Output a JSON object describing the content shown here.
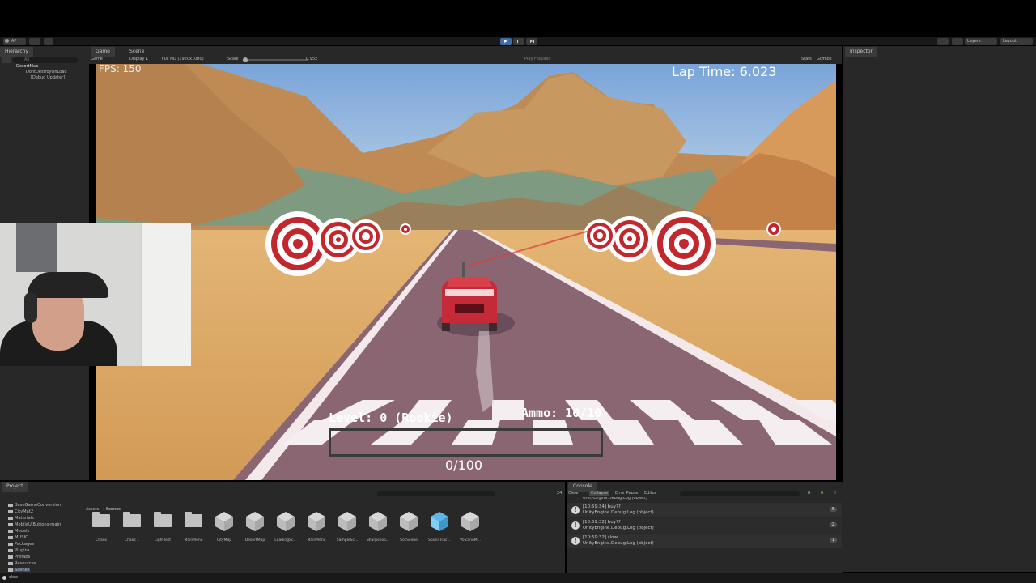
{
  "toolbar": {
    "account_label": "AP",
    "layers_label": "Layers",
    "layout_label": "Layout"
  },
  "hierarchy": {
    "tab_label": "Hierarchy",
    "search_placeholder": "All",
    "items": [
      {
        "label": "DesertMap"
      },
      {
        "label": "DontDestroyOnLoad"
      },
      {
        "label": "[Debug Updater]"
      }
    ]
  },
  "game_view": {
    "tabs": [
      {
        "label": "Game"
      },
      {
        "label": "Scene"
      }
    ],
    "display_mode": "Game",
    "display": "Display 1",
    "resolution": "Full HD (1920x1080)",
    "scale_label": "Scale",
    "scale_value": "0.95x",
    "play_mode": "Play Focused",
    "stats_label": "Stats",
    "gizmos_label": "Gizmos"
  },
  "inspector": {
    "tab_label": "Inspector"
  },
  "hud": {
    "fps": "FPS: 150",
    "lap_time": "Lap Time: 6.023",
    "level": "Level: 0 (Rookie)",
    "ammo": "Ammo: 10/10",
    "progress_text": "0/100",
    "progress_fraction": 0.0
  },
  "project": {
    "tab_label": "Project",
    "breadcrumb": [
      "Assets",
      "Scenes"
    ],
    "asset_count": "24",
    "tree": [
      {
        "label": "BaseGameConversion"
      },
      {
        "label": "CityMat2"
      },
      {
        "label": "Materials"
      },
      {
        "label": "MobileUIButtons-main"
      },
      {
        "label": "Models"
      },
      {
        "label": "MUSIC"
      },
      {
        "label": "Packages"
      },
      {
        "label": "Plugins"
      },
      {
        "label": "Prefabs"
      },
      {
        "label": "Resources"
      },
      {
        "label": "Scenes"
      }
    ],
    "assets": [
      {
        "label": "Chaos",
        "icon": "folder-icon"
      },
      {
        "label": "Chaos 1",
        "icon": "folder-icon"
      },
      {
        "label": "LightTest",
        "icon": "folder-icon"
      },
      {
        "label": "MainMenu",
        "icon": "folder-icon"
      },
      {
        "label": "CityMap",
        "icon": "unity-scene-icon"
      },
      {
        "label": "DesertMap",
        "icon": "unity-scene-icon"
      },
      {
        "label": "LoadingSc...",
        "icon": "unity-scene-icon"
      },
      {
        "label": "MainMenu",
        "icon": "unity-scene-icon"
      },
      {
        "label": "SampleSc...",
        "icon": "unity-scene-icon"
      },
      {
        "label": "Sharpshoo...",
        "icon": "unity-scene-icon"
      },
      {
        "label": "SocScene",
        "icon": "unity-scene-icon"
      },
      {
        "label": "SoundTrac...",
        "icon": "cube-icon"
      },
      {
        "label": "VolcanoM...",
        "icon": "unity-scene-icon"
      }
    ]
  },
  "console": {
    "tab_label": "Console",
    "buttons": {
      "clear": "Clear",
      "collapse": "Collapse",
      "error_pause": "Error Pause",
      "editor": "Editor"
    },
    "counts": {
      "info": "8",
      "warn": "0",
      "error": "0"
    },
    "partial_row": "UnityEngine.Debug:Log (object)",
    "logs": [
      {
        "time_msg": "[10:59:34] buy??",
        "detail": "UnityEngine.Debug:Log (object)",
        "count": "5"
      },
      {
        "time_msg": "[10:59:32] buy??",
        "detail": "UnityEngine.Debug:Log (object)",
        "count": "2"
      },
      {
        "time_msg": "[10:59:32] slow",
        "detail": "UnityEngine.Debug:Log (object)",
        "count": "1"
      }
    ]
  },
  "status_bar": {
    "message": "slow"
  }
}
